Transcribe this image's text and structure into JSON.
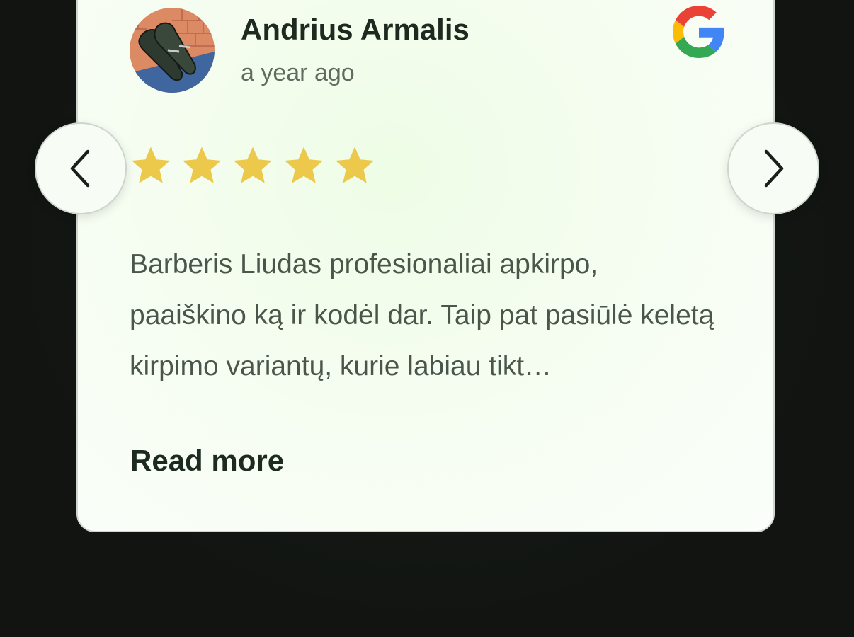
{
  "review": {
    "author_name": "Andrius Armalis",
    "time_ago": "a year ago",
    "rating": 5,
    "rating_max": 5,
    "text": "Barberis Liudas profesionaliai apkirpo, paaiškino ką ir kodėl dar. Taip pat pasiūlė keletą kirpimo variantų, kurie labiau tikt…",
    "read_more_label": "Read more",
    "source_icon": "google-icon",
    "avatar_icon": "avatar-shoes-illustration"
  },
  "navigation": {
    "prev_icon": "chevron-left-icon",
    "next_icon": "chevron-right-icon"
  },
  "colors": {
    "page_background": "#111411",
    "card_background": "#f5fdf0",
    "star": "#ecc94b",
    "name_text": "#1d2a1f",
    "body_text": "#4a564b",
    "meta_text": "#5f6b60"
  }
}
